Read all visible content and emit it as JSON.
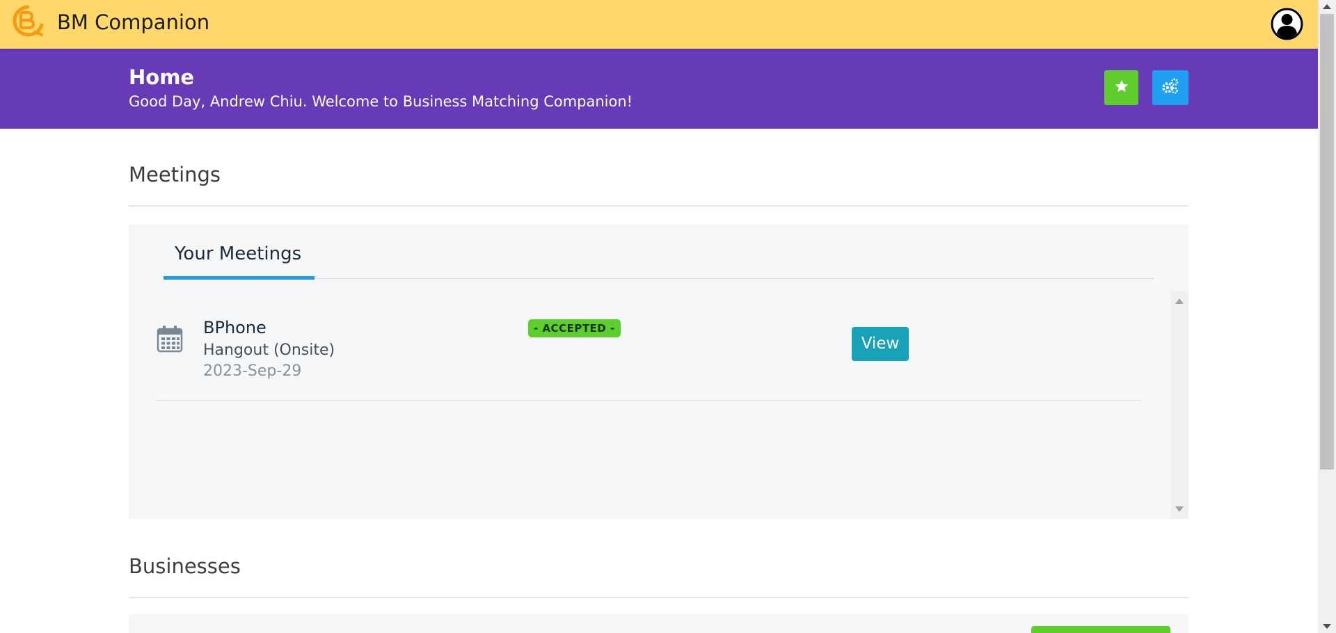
{
  "app": {
    "title": "BM Companion",
    "logo_icon": "bm-logo-icon",
    "account_icon": "user-account-icon"
  },
  "header": {
    "title": "Home",
    "subtitle": "Good Day, Andrew Chiu. Welcome to Business Matching Companion!",
    "favorites_icon": "star-icon",
    "settings_icon": "gears-icon"
  },
  "meetings": {
    "section_title": "Meetings",
    "tabs": [
      {
        "label": "Your Meetings",
        "active": true
      }
    ],
    "items": [
      {
        "name": "BPhone",
        "type": "Hangout (Onsite)",
        "date": "2023-Sep-29",
        "status": "- ACCEPTED -",
        "action_label": "View",
        "icon": "calendar-icon"
      }
    ]
  },
  "businesses": {
    "section_title": "Businesses"
  },
  "colors": {
    "topbar": "#ffd76a",
    "header": "#673ab7",
    "favorites_button": "#5fce2d",
    "settings_button": "#20a0f0",
    "tab_indicator": "#1e9be9",
    "status_badge": "#5ccf2c",
    "view_button": "#17a2b8"
  }
}
